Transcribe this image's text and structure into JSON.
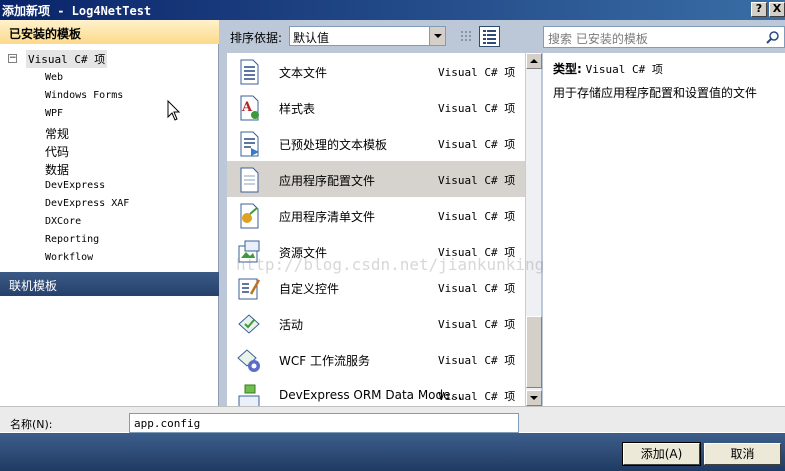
{
  "window": {
    "title": "添加新项 - Log4NetTest",
    "help_label": "?",
    "close_label": "X"
  },
  "left_panel": {
    "installed_header": "已安装的模板",
    "root": {
      "label": "Visual C# 项",
      "expander": "⊟"
    },
    "items": [
      {
        "label": "Web"
      },
      {
        "label": "Windows Forms"
      },
      {
        "label": "WPF"
      },
      {
        "label": "常规"
      },
      {
        "label": "代码"
      },
      {
        "label": "数据"
      },
      {
        "label": "DevExpress"
      },
      {
        "label": "DevExpress XAF"
      },
      {
        "label": "DXCore"
      },
      {
        "label": "Reporting"
      },
      {
        "label": "Workflow"
      }
    ],
    "online_header": "联机模板"
  },
  "toolbar": {
    "sort_label": "排序依据:",
    "sort_value": "默认值",
    "view_small_icon": "small-icons-view-icon",
    "view_list_icon": "list-view-icon"
  },
  "templates": [
    {
      "name": "文本文件",
      "type": "Visual C# 项",
      "icon": "text-file-icon",
      "selected": false
    },
    {
      "name": "样式表",
      "type": "Visual C# 项",
      "icon": "stylesheet-icon",
      "selected": false
    },
    {
      "name": "已预处理的文本模板",
      "type": "Visual C# 项",
      "icon": "preprocessed-template-icon",
      "selected": false
    },
    {
      "name": "应用程序配置文件",
      "type": "Visual C# 项",
      "icon": "config-file-icon",
      "selected": true
    },
    {
      "name": "应用程序清单文件",
      "type": "Visual C# 项",
      "icon": "manifest-file-icon",
      "selected": false
    },
    {
      "name": "资源文件",
      "type": "Visual C# 项",
      "icon": "resource-file-icon",
      "selected": false
    },
    {
      "name": "自定义控件",
      "type": "Visual C# 项",
      "icon": "custom-control-icon",
      "selected": false
    },
    {
      "name": "活动",
      "type": "Visual C# 项",
      "icon": "activity-icon",
      "selected": false
    },
    {
      "name": "WCF 工作流服务",
      "type": "Visual C# 项",
      "icon": "wcf-workflow-service-icon",
      "selected": false
    },
    {
      "name": "DevExpress ORM Data Mode…",
      "type": "Visual C# 项",
      "icon": "orm-data-model-icon",
      "selected": false
    }
  ],
  "search": {
    "placeholder": "搜索 已安装的模板"
  },
  "details": {
    "type_label": "类型:",
    "type_value": "Visual C# 项",
    "description": "用于存储应用程序配置和设置值的文件"
  },
  "name_field": {
    "label": "名称(N):",
    "value": "app.config"
  },
  "buttons": {
    "add": "添加(A)",
    "cancel": "取消"
  },
  "watermark": "http://blog.csdn.net/jiankunking"
}
